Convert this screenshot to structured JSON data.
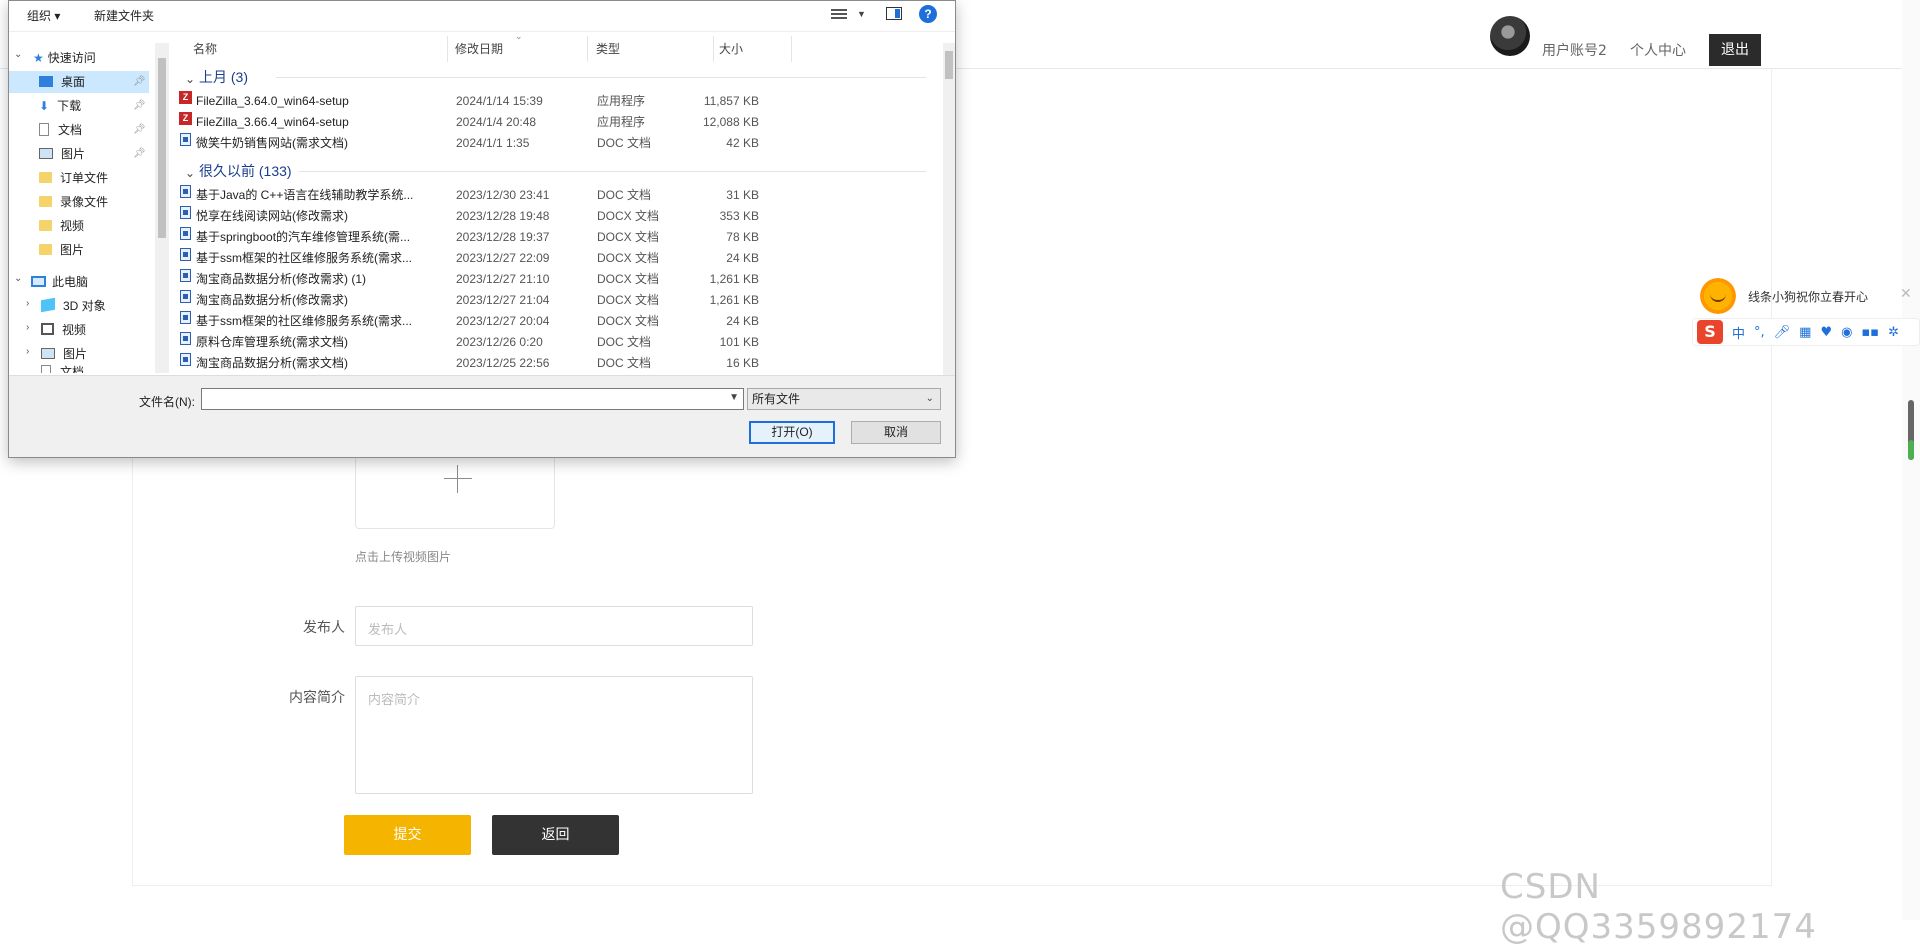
{
  "web": {
    "user_account": "用户账号2",
    "profile_link": "个人中心",
    "logout": "退出",
    "upload_hint": "点击上传视频图片",
    "publisher_label": "发布人",
    "publisher_placeholder": "发布人",
    "summary_label": "内容简介",
    "summary_placeholder": "内容简介",
    "submit": "提交",
    "back": "返回",
    "watermark": "CSDN @QQ3359892174"
  },
  "ime": {
    "tip_text": "线条小狗祝你立春开心",
    "lang": "中",
    "close": "✕",
    "s_logo": "S"
  },
  "dialog": {
    "toolbar": {
      "organize": "组织 ▾",
      "new_folder": "新建文件夹",
      "help": "?"
    },
    "nav": {
      "quick_access": "快速访问",
      "items": [
        "桌面",
        "下载",
        "文档",
        "图片",
        "订单文件",
        "录像文件",
        "视频",
        "图片"
      ],
      "this_pc": "此电脑",
      "pc_items": [
        "3D 对象",
        "视频",
        "图片",
        "文档"
      ]
    },
    "columns": {
      "name": "名称",
      "date": "修改日期",
      "type": "类型",
      "size": "大小"
    },
    "groups": [
      {
        "title": "上月 (3)",
        "files": [
          {
            "icon": "filezilla-icon",
            "name": "FileZilla_3.64.0_win64-setup",
            "date": "2024/1/14 15:39",
            "type": "应用程序",
            "size": "11,857 KB"
          },
          {
            "icon": "filezilla-icon",
            "name": "FileZilla_3.66.4_win64-setup",
            "date": "2024/1/4 20:48",
            "type": "应用程序",
            "size": "12,088 KB"
          },
          {
            "icon": "doc-icon",
            "name": "微笑牛奶销售网站(需求文档)",
            "date": "2024/1/1 1:35",
            "type": "DOC 文档",
            "size": "42 KB"
          }
        ]
      },
      {
        "title": "很久以前 (133)",
        "files": [
          {
            "icon": "doc-icon",
            "name": "基于Java的 C++语言在线辅助教学系统...",
            "date": "2023/12/30 23:41",
            "type": "DOC 文档",
            "size": "31 KB"
          },
          {
            "icon": "doc-icon",
            "name": "悦享在线阅读网站(修改需求)",
            "date": "2023/12/28 19:48",
            "type": "DOCX 文档",
            "size": "353 KB"
          },
          {
            "icon": "doc-icon",
            "name": "基于springboot的汽车维修管理系统(需...",
            "date": "2023/12/28 19:37",
            "type": "DOCX 文档",
            "size": "78 KB"
          },
          {
            "icon": "doc-icon",
            "name": "基于ssm框架的社区维修服务系统(需求...",
            "date": "2023/12/27 22:09",
            "type": "DOCX 文档",
            "size": "24 KB"
          },
          {
            "icon": "doc-icon",
            "name": "淘宝商品数据分析(修改需求) (1)",
            "date": "2023/12/27 21:10",
            "type": "DOCX 文档",
            "size": "1,261 KB"
          },
          {
            "icon": "doc-icon",
            "name": "淘宝商品数据分析(修改需求)",
            "date": "2023/12/27 21:04",
            "type": "DOCX 文档",
            "size": "1,261 KB"
          },
          {
            "icon": "doc-icon",
            "name": "基于ssm框架的社区维修服务系统(需求...",
            "date": "2023/12/27 20:04",
            "type": "DOCX 文档",
            "size": "24 KB"
          },
          {
            "icon": "doc-icon",
            "name": "原料仓库管理系统(需求文档)",
            "date": "2023/12/26 0:20",
            "type": "DOC 文档",
            "size": "101 KB"
          },
          {
            "icon": "doc-icon",
            "name": "淘宝商品数据分析(需求文档)",
            "date": "2023/12/25 22:56",
            "type": "DOC 文档",
            "size": "16 KB"
          }
        ]
      }
    ],
    "filename_label": "文件名(N):",
    "filename_value": "",
    "filetype_value": "所有文件",
    "open": "打开(O)",
    "cancel": "取消"
  },
  "colors": {
    "accent_yellow": "#f5b400",
    "dark_button": "#333333",
    "selection": "#cce8ff",
    "group_title": "#1a3e8c"
  }
}
